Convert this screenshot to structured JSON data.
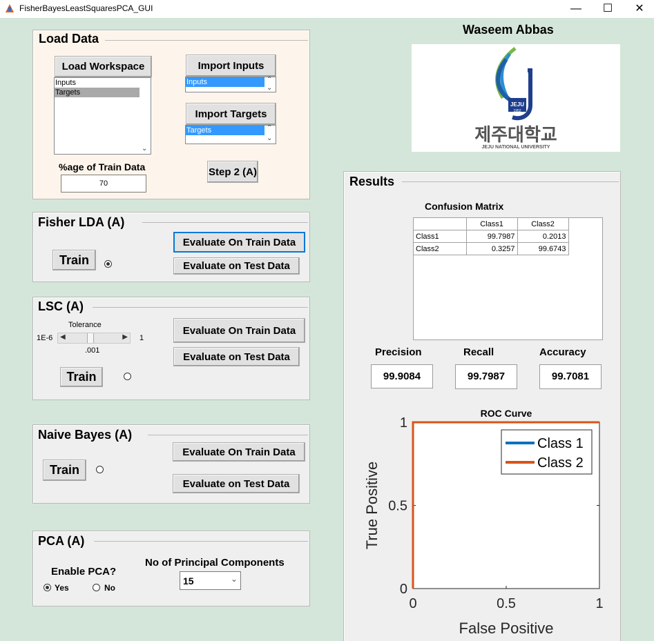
{
  "window": {
    "title": "FisherBayesLeastSquaresPCA_GUI",
    "minimize": "—",
    "maximize": "☐",
    "close": "✕"
  },
  "author": "Waseem Abbas",
  "logo": {
    "badge": "JEJU",
    "year": "1952",
    "korean": "제주대학교",
    "english": "JEJU NATIONAL UNIVERSITY"
  },
  "load_data": {
    "title": "Load Data",
    "load_workspace": "Load Workspace",
    "workspace_items": [
      "Inputs",
      "Targets"
    ],
    "import_inputs": "Import Inputs",
    "inputs_selected": "Inputs",
    "import_targets": "Import Targets",
    "targets_selected": "Targets",
    "train_pct_label": "%age of Train Data",
    "train_pct_value": "70",
    "step2": "Step 2 (A)"
  },
  "fisher": {
    "title": "Fisher LDA (A)",
    "train": "Train",
    "eval_train": "Evaluate On Train Data",
    "eval_test": "Evaluate on Test Data",
    "radio_selected": true
  },
  "lsc": {
    "title": "LSC (A)",
    "tolerance_label": "Tolerance",
    "slider_min": "1E-6",
    "slider_max": "1",
    "slider_value": ".001",
    "train": "Train",
    "eval_train": "Evaluate On Train Data",
    "eval_test": "Evaluate on Test Data"
  },
  "bayes": {
    "title": "Naive Bayes (A)",
    "train": "Train",
    "eval_train": "Evaluate On Train Data",
    "eval_test": "Evaluate on Test Data"
  },
  "pca": {
    "title": "PCA (A)",
    "enable_label": "Enable PCA?",
    "yes": "Yes",
    "no": "No",
    "components_label": "No of Principal Components",
    "components_value": "15"
  },
  "results": {
    "title": "Results",
    "cm_title": "Confusion Matrix",
    "cm_headers": [
      "Class1",
      "Class2"
    ],
    "cm_rows": [
      {
        "label": "Class1",
        "values": [
          "99.7987",
          "0.2013"
        ]
      },
      {
        "label": "Class2",
        "values": [
          "0.3257",
          "99.6743"
        ]
      }
    ],
    "precision_label": "Precision",
    "precision": "99.9084",
    "recall_label": "Recall",
    "recall": "99.7987",
    "accuracy_label": "Accuracy",
    "accuracy": "99.7081"
  },
  "chart_data": {
    "type": "line",
    "title": "ROC Curve",
    "xlabel": "False Positive",
    "ylabel": "True Positive",
    "xlim": [
      0,
      1
    ],
    "ylim": [
      0,
      1
    ],
    "xticks": [
      "0",
      "0.5",
      "1"
    ],
    "yticks": [
      "0",
      "0.5",
      "1"
    ],
    "legend_position": "top-right",
    "series": [
      {
        "name": "Class 1",
        "color": "#0072bd",
        "x": [
          0,
          0,
          1
        ],
        "y": [
          0,
          1,
          1
        ]
      },
      {
        "name": "Class 2",
        "color": "#d95319",
        "x": [
          0,
          0,
          1
        ],
        "y": [
          0,
          1,
          1
        ]
      }
    ]
  }
}
